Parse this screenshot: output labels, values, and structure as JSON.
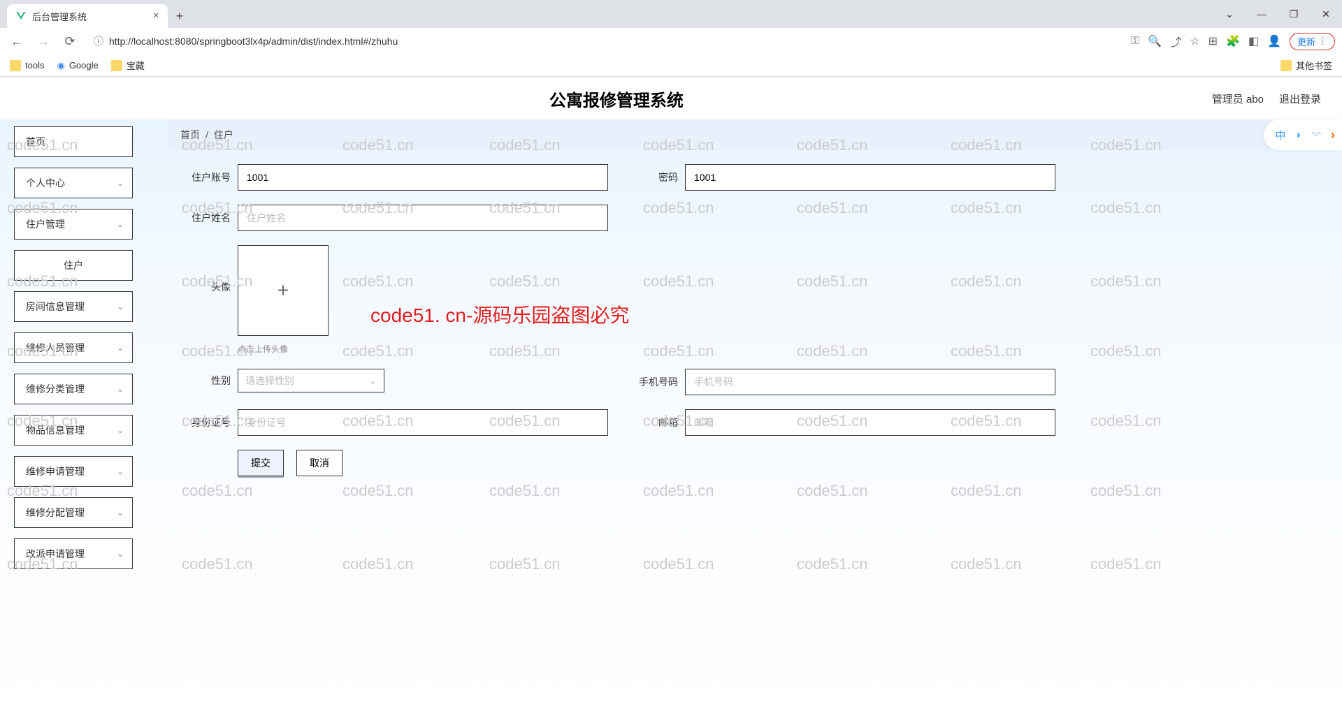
{
  "browser": {
    "tab_title": "后台管理系统",
    "url": "http://localhost:8080/springboot3lx4p/admin/dist/index.html#/zhuhu",
    "update_label": "更新",
    "bookmarks": {
      "tools": "tools",
      "google": "Google",
      "treasure": "宝藏",
      "other": "其他书签"
    }
  },
  "header": {
    "title": "公寓报修管理系统",
    "user": "管理员 abo",
    "logout": "退出登录"
  },
  "sidebar": {
    "items": [
      {
        "label": "首页",
        "expandable": false
      },
      {
        "label": "个人中心",
        "expandable": true
      },
      {
        "label": "住户管理",
        "expandable": true
      },
      {
        "label": "住户",
        "expandable": false,
        "sub": true
      },
      {
        "label": "房间信息管理",
        "expandable": true
      },
      {
        "label": "维修人员管理",
        "expandable": true
      },
      {
        "label": "维修分类管理",
        "expandable": true
      },
      {
        "label": "物品信息管理",
        "expandable": true
      },
      {
        "label": "维修申请管理",
        "expandable": true
      },
      {
        "label": "维修分配管理",
        "expandable": true
      },
      {
        "label": "改派申请管理",
        "expandable": true
      }
    ]
  },
  "breadcrumb": {
    "home": "首页",
    "sep": "/",
    "current": "住户"
  },
  "floating": {
    "lang": "中",
    "moon": "◗",
    "glasses": "ᵔᵕᵔ"
  },
  "form": {
    "account": {
      "label": "住户账号",
      "value": "1001"
    },
    "password": {
      "label": "密码",
      "value": "1001"
    },
    "name": {
      "label": "住户姓名",
      "placeholder": "住户姓名",
      "value": ""
    },
    "avatar": {
      "label": "头像",
      "hint": "点击上传头像"
    },
    "gender": {
      "label": "性别",
      "placeholder": "请选择性别"
    },
    "phone": {
      "label": "手机号码",
      "placeholder": "手机号码",
      "value": ""
    },
    "idcard": {
      "label": "身份证号",
      "placeholder": "身份证号",
      "value": ""
    },
    "email": {
      "label": "邮箱",
      "placeholder": "邮箱",
      "value": ""
    },
    "submit": "提交",
    "cancel": "取消"
  },
  "watermark": {
    "text": "code51.cn",
    "red": "code51. cn-源码乐园盗图必究"
  }
}
